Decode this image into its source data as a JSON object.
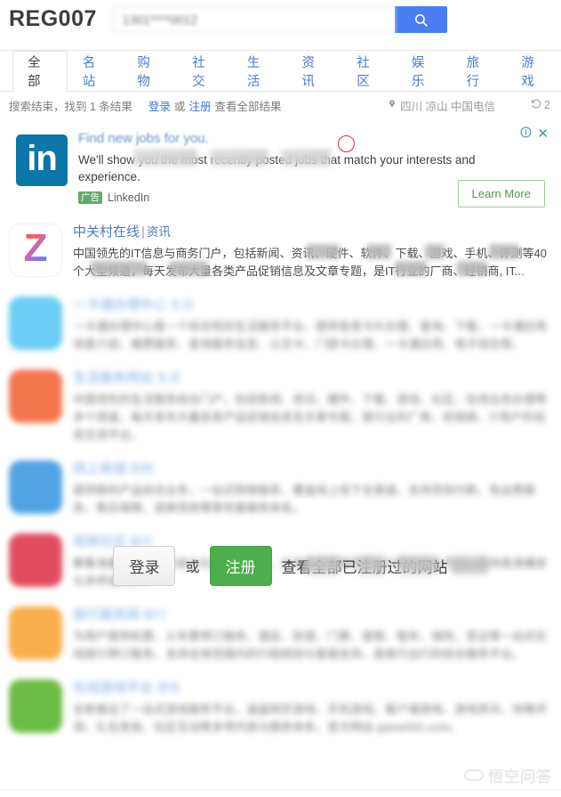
{
  "header": {
    "logo": "REG007",
    "search": {
      "value": "1301****0012",
      "placeholder": "",
      "button_icon": "search-icon"
    }
  },
  "tabs": [
    {
      "label": "全部",
      "active": true
    },
    {
      "label": "名站",
      "active": false
    },
    {
      "label": "购物",
      "active": false
    },
    {
      "label": "社交",
      "active": false
    },
    {
      "label": "生活",
      "active": false
    },
    {
      "label": "资讯",
      "active": false
    },
    {
      "label": "社区",
      "active": false
    },
    {
      "label": "娱乐",
      "active": false
    },
    {
      "label": "旅行",
      "active": false
    },
    {
      "label": "游戏",
      "active": false
    }
  ],
  "status": {
    "result_text": "搜索结束，找到 1 条结果",
    "login_link": "登录",
    "or": "或",
    "register_link": "注册",
    "view_all": "查看全部结果",
    "location_icon": "map-pin-icon",
    "location": "四川 凉山 中国电信",
    "history_icon": "history-icon",
    "count": "2"
  },
  "ad": {
    "logo_text": "in",
    "logo_color": "#0b76a8",
    "title": "Find new jobs for you.",
    "description": "We'll show you the most recently posted jobs that match your interests and experience.",
    "badge": "广告",
    "brand": "LinkedIn",
    "cta": "Learn More",
    "info_icon": "info-circle-icon",
    "close_icon": "close-icon",
    "annotation": "red-circle-marker"
  },
  "results": [
    {
      "title": "中关村在线",
      "separator": "|",
      "category": "资讯",
      "icon": "zol-logo-icon",
      "icon_color": "#f7456f",
      "description": "中国领先的IT信息与商务门户，包括新闻、资讯、硬件、软件、下载、游戏、手机、评测等40 个大型频道，每天发布大量各类产品促销信息及文章专题，是IT行业的厂商、经销商, IT...",
      "blurred": false
    },
    {
      "title": "",
      "separator": "|",
      "category": "",
      "icon": "app-icon",
      "icon_color": "#5bc8f5",
      "description": "",
      "blurred": true
    },
    {
      "title": "",
      "separator": "|",
      "category": "",
      "icon": "app-icon",
      "icon_color": "#f2683c",
      "description": "",
      "blurred": true
    },
    {
      "title": "",
      "separator": "|",
      "category": "",
      "icon": "app-icon",
      "icon_color": "#3f9ae0",
      "description": "",
      "blurred": true
    },
    {
      "title": "",
      "separator": "|",
      "category": "",
      "icon": "app-icon",
      "icon_color": "#de3a4e",
      "description": "",
      "blurred": true
    },
    {
      "title": "",
      "separator": "|",
      "category": "",
      "icon": "app-icon",
      "icon_color": "#f9a council",
      "description": "",
      "blurred": true
    },
    {
      "title": "",
      "separator": "|",
      "category": "",
      "icon": "app-icon",
      "icon_color": "#5cb531",
      "description": "",
      "blurred": true
    }
  ],
  "overlay": {
    "login_button": "登录",
    "or": "或",
    "register_button": "注册",
    "text": "查看全部已注册过的网站"
  },
  "watermark": {
    "text": "悟空问答"
  },
  "colors": {
    "accent_blue": "#4a7df2",
    "tab_link": "#4b7bd0",
    "link": "#3b76d0",
    "ad_green": "#61ae6a",
    "register_green": "#4cae4c",
    "linkedin_blue": "#0b76a8",
    "teal": "#3f9c9c",
    "annotation_red": "#d32f2f"
  }
}
